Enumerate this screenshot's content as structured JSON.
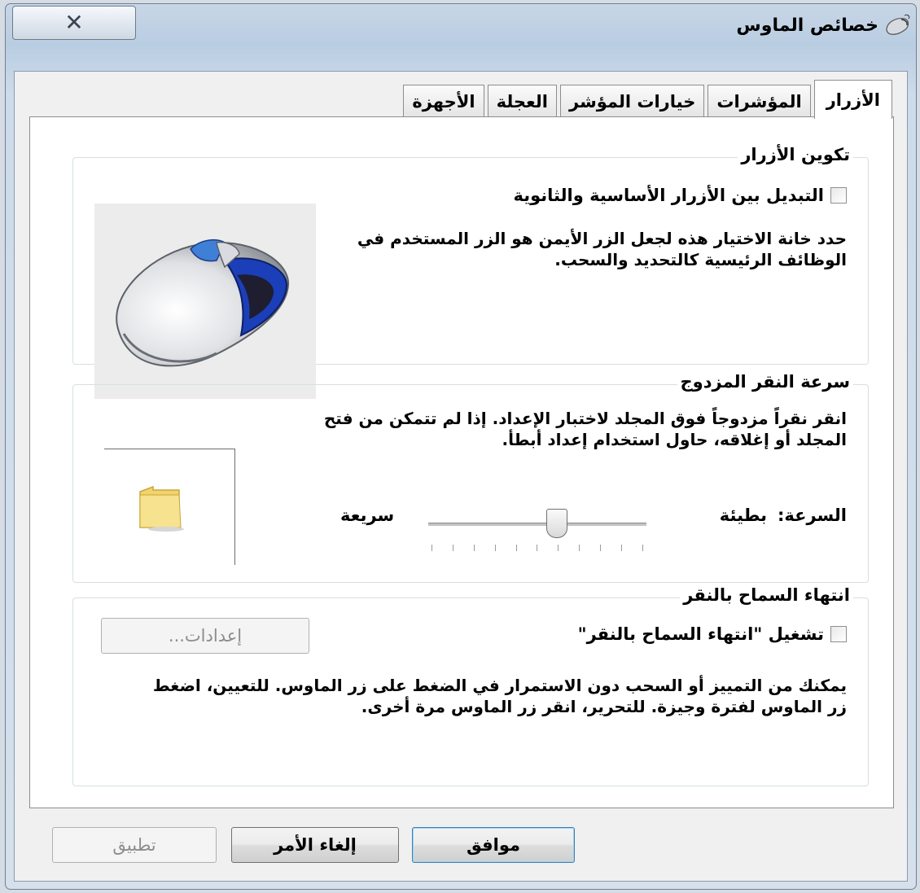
{
  "window": {
    "title": "خصائص الماوس",
    "close_glyph": "✕"
  },
  "tabs": [
    {
      "label": "الأزرار",
      "active": true
    },
    {
      "label": "المؤشرات",
      "active": false
    },
    {
      "label": "خيارات المؤشر",
      "active": false
    },
    {
      "label": "العجلة",
      "active": false
    },
    {
      "label": "الأجهزة",
      "active": false
    }
  ],
  "button_config": {
    "legend": "تكوين الأزرار",
    "switch_label": "التبديل بين الأزرار الأساسية والثانوية",
    "switch_checked": false,
    "description": "حدد خانة الاختيار هذه لجعل الزر الأيمن هو الزر المستخدم في الوظائف الرئيسية كالتحديد والسحب."
  },
  "double_click": {
    "legend": "سرعة النقر المزدوج",
    "description": "انقر نقراً مزدوجاً فوق المجلد لاختبار الإعداد. إذا لم تتمكن من فتح المجلد أو إغلاقه، حاول استخدام إعداد أبطأ.",
    "speed_label": "السرعة:",
    "slow_label": "بطيئة",
    "fast_label": "سريعة",
    "speed_fraction": 0.4
  },
  "click_lock": {
    "legend": "انتهاء السماح بالنقر",
    "enable_label": "تشغيل \"انتهاء السماح بالنقر\"",
    "enable_checked": false,
    "settings_label": "إعدادات...",
    "description": "يمكنك من التمييز أو السحب دون الاستمرار في الضغط على زر الماوس. للتعيين، اضغط زر الماوس لفترة وجيزة. للتحرير، انقر زر الماوس مرة أخرى."
  },
  "footer": {
    "ok_label": "موافق",
    "cancel_label": "إلغاء الأمر",
    "apply_label": "تطبيق"
  },
  "colors": {
    "accent_blue": "#1b3fb8",
    "folder_yellow": "#f2d46a"
  }
}
